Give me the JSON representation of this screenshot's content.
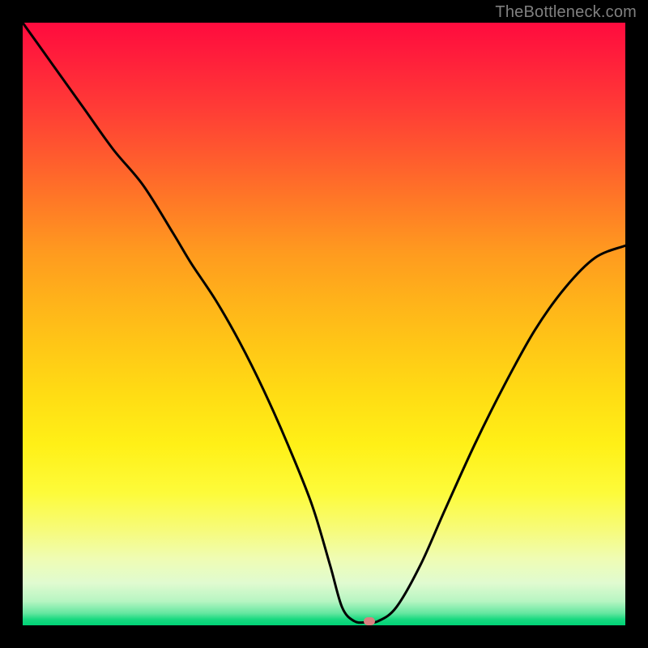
{
  "watermark": "TheBottleneck.com",
  "marker": {
    "x_pct": 57.5,
    "y_pct": 99.3
  },
  "chart_data": {
    "type": "line",
    "title": "",
    "xlabel": "",
    "ylabel": "",
    "xlim": [
      0,
      100
    ],
    "ylim": [
      0,
      100
    ],
    "note": "No axis ticks or numeric labels are visible; x and y are normalized percentages of the plot area (0=left/bottom, 100=right/top). Curve points are visual estimates.",
    "series": [
      {
        "name": "bottleneck-curve",
        "x": [
          0,
          5,
          10,
          15,
          20,
          25,
          28,
          32,
          36,
          40,
          44,
          48,
          51,
          53,
          55,
          57,
          59,
          62,
          66,
          70,
          75,
          80,
          85,
          90,
          95,
          100
        ],
        "y": [
          100,
          93,
          86,
          79,
          73,
          65,
          60,
          54,
          47,
          39,
          30,
          20,
          10,
          3,
          0.7,
          0.5,
          0.7,
          3,
          10,
          19,
          30,
          40,
          49,
          56,
          61,
          63
        ]
      }
    ],
    "marker_point": {
      "x": 57.5,
      "y": 0.7
    },
    "background_gradient": {
      "top_color": "#ff0b3e",
      "mid_color": "#ffdd14",
      "bottom_color": "#00d276"
    }
  }
}
